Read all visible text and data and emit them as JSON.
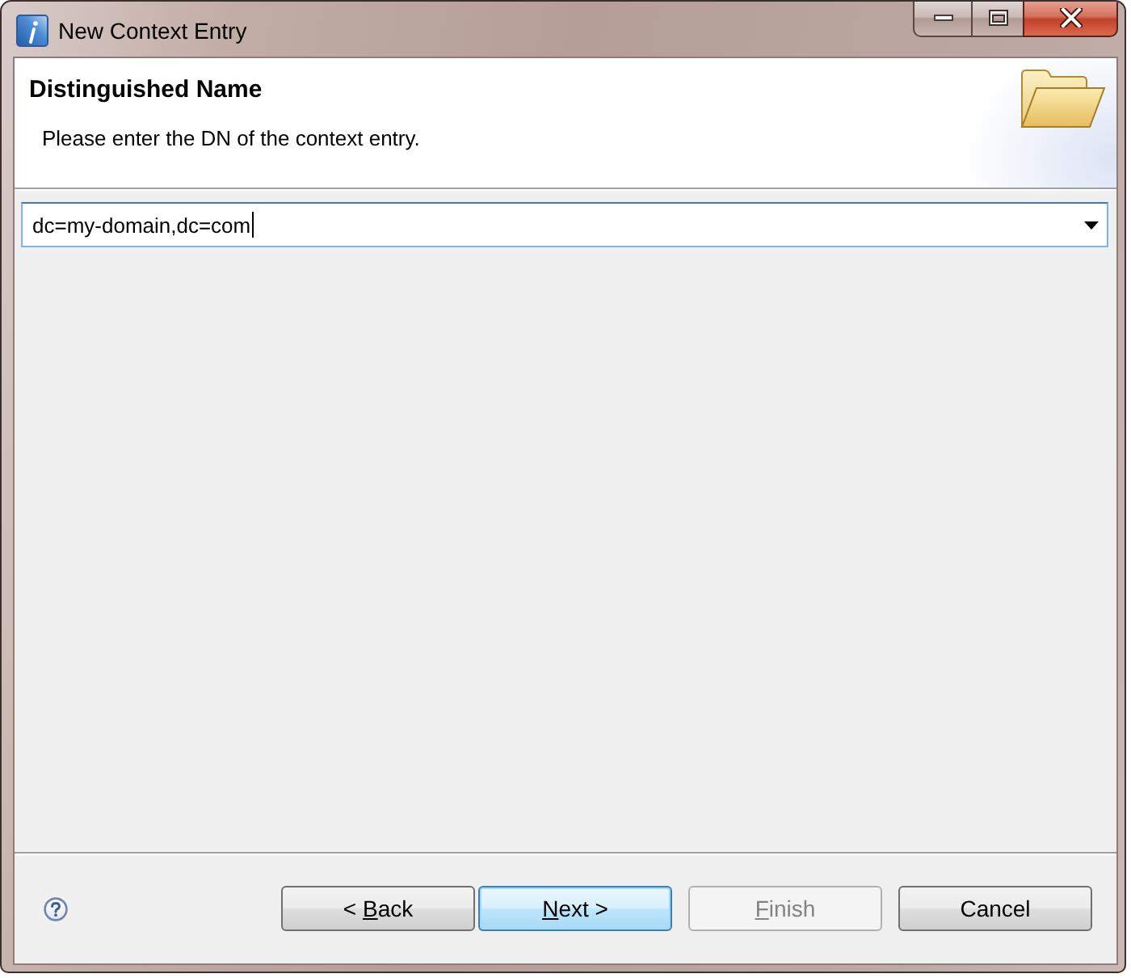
{
  "window": {
    "title": "New Context Entry"
  },
  "header": {
    "title": "Distinguished Name",
    "description": "Please enter the DN of the context entry."
  },
  "dn_field": {
    "value": "dc=my-domain,dc=com",
    "focused": true
  },
  "buttons": [
    {
      "label": [
        {
          "text": "< ",
          "underlined": false
        },
        {
          "text": "B",
          "underlined": true
        },
        {
          "text": "ack",
          "underlined": false
        }
      ],
      "default": false,
      "disabled": false
    },
    {
      "label": [
        {
          "text": "N",
          "underlined": true
        },
        {
          "text": "ext >",
          "underlined": false
        }
      ],
      "default": true,
      "disabled": false
    },
    {
      "label": [
        {
          "text": "F",
          "underlined": true
        },
        {
          "text": "inish",
          "underlined": false
        }
      ],
      "default": false,
      "disabled": true
    },
    {
      "label": [
        {
          "text": "Cancel",
          "underlined": false
        }
      ],
      "default": false,
      "disabled": false
    }
  ]
}
